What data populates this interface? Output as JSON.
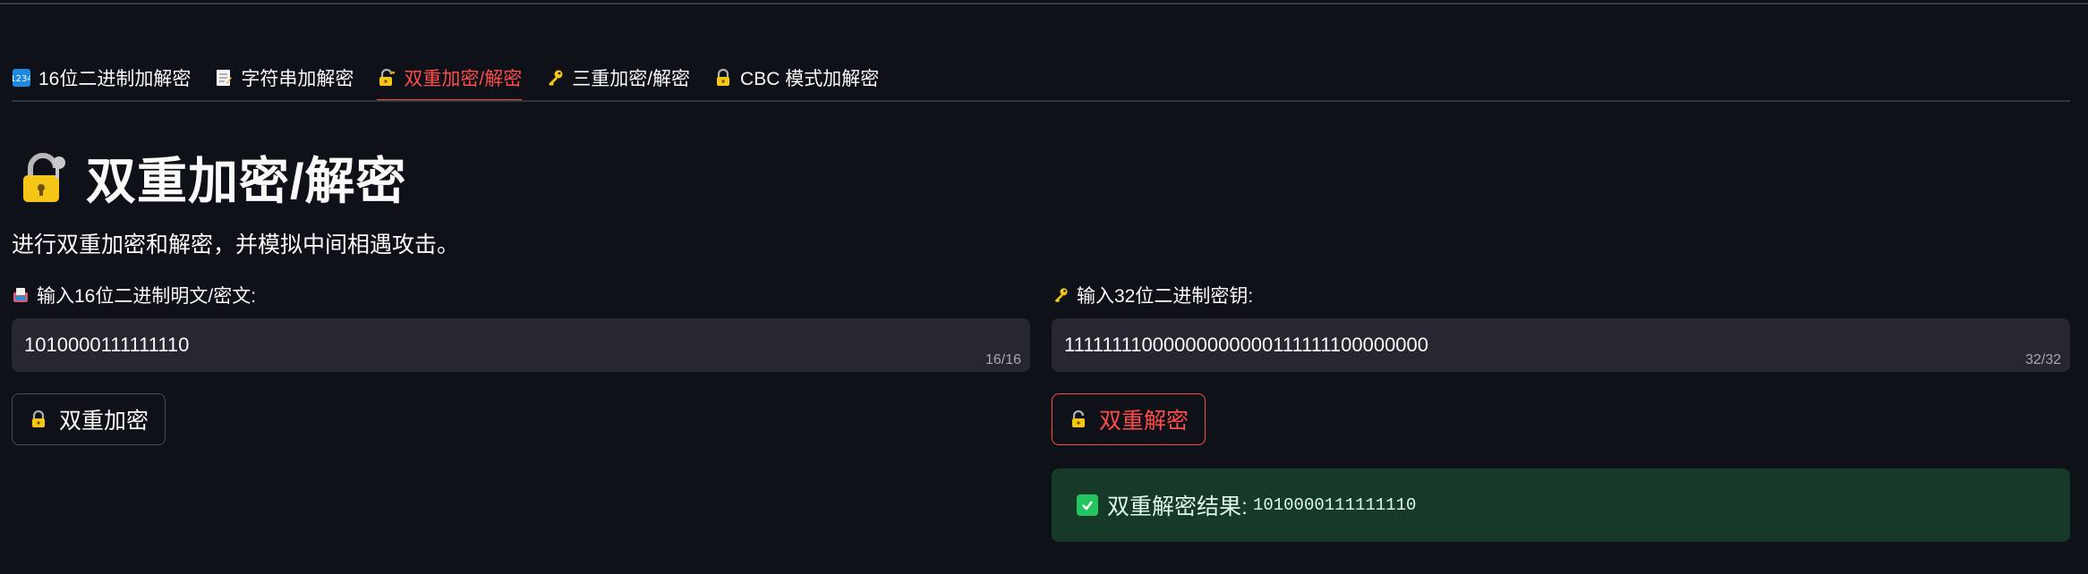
{
  "tabs": [
    {
      "label": "16位二进制加解密",
      "icon": "numbers-icon"
    },
    {
      "label": "字符串加解密",
      "icon": "memo-icon"
    },
    {
      "label": "双重加密/解密",
      "icon": "lock-with-key-icon",
      "active": true
    },
    {
      "label": "三重加密/解密",
      "icon": "key-icon"
    },
    {
      "label": "CBC 模式加解密",
      "icon": "lock-icon"
    }
  ],
  "page": {
    "title": "双重加密/解密",
    "subtitle": "进行双重加密和解密，并模拟中间相遇攻击。"
  },
  "left": {
    "label": "输入16位二进制明文/密文:",
    "value": "1010000111111110",
    "counter": "16/16",
    "button": "双重加密"
  },
  "right": {
    "label": "输入32位二进制密钥:",
    "value": "11111111000000000000111111100000000",
    "counter": "32/32",
    "button": "双重解密"
  },
  "result": {
    "label": "双重解密结果:",
    "value": "1010000111111110"
  },
  "colors": {
    "background": "#0e1117",
    "accent": "#ff4b4b",
    "input_bg": "#262730",
    "success_bg": "#173928"
  }
}
